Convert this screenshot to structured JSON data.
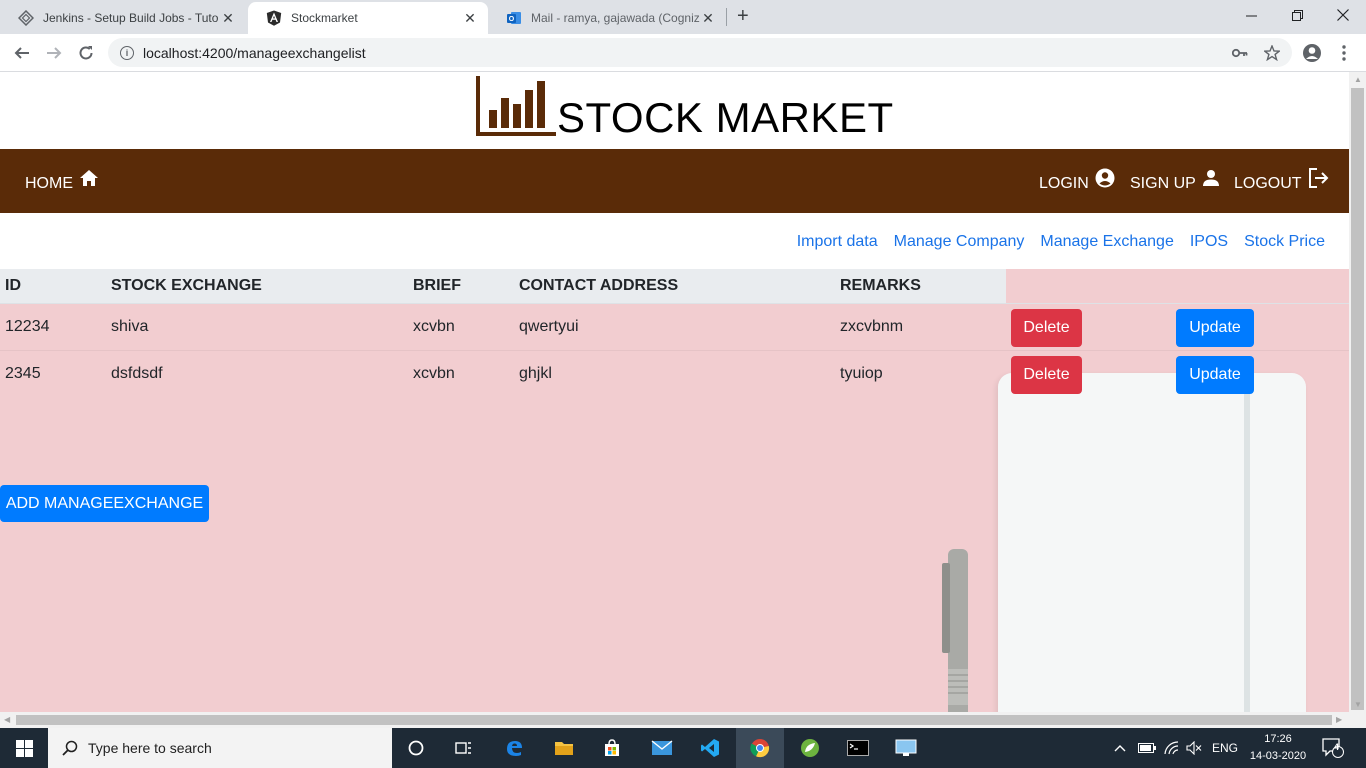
{
  "browser": {
    "tabs": [
      {
        "title": "Jenkins - Setup Build Jobs - Tuto",
        "icon": "jenkins-icon"
      },
      {
        "title": "Stockmarket",
        "icon": "angular-icon"
      },
      {
        "title": "Mail - ramya, gajawada (Cogniza",
        "icon": "outlook-icon"
      }
    ],
    "url": "localhost:4200/manageexchangelist"
  },
  "brand": {
    "name": "STOCK MARKET"
  },
  "nav": {
    "home": "HOME",
    "login": "LOGIN",
    "signup": "SIGN UP",
    "logout": "LOGOUT"
  },
  "sublinks": [
    "Import data",
    "Manage Company",
    "Manage Exchange",
    "IPOS",
    "Stock Price"
  ],
  "table": {
    "headers": [
      "ID",
      "STOCK EXCHANGE",
      "BRIEF",
      "CONTACT ADDRESS",
      "REMARKS"
    ],
    "rows": [
      {
        "id": "12234",
        "exchange": "shiva",
        "brief": "xcvbn",
        "address": "qwertyui",
        "remarks": "zxcvbnm"
      },
      {
        "id": "2345",
        "exchange": "dsfdsdf",
        "brief": "xcvbn",
        "address": "ghjkl",
        "remarks": "tyuiop"
      }
    ],
    "delete_label": "Delete",
    "update_label": "Update"
  },
  "add_button": "ADD MANAGEEXCHANGE",
  "taskbar": {
    "search_placeholder": "Type here to search",
    "language": "ENG",
    "time": "17:26",
    "date": "14-03-2020",
    "notifications": "4"
  },
  "colors": {
    "navbar": "#5a2b08",
    "content_bg": "#f2cdd0",
    "link": "#1a73e8",
    "danger": "#dc3545",
    "primary": "#007bff"
  }
}
